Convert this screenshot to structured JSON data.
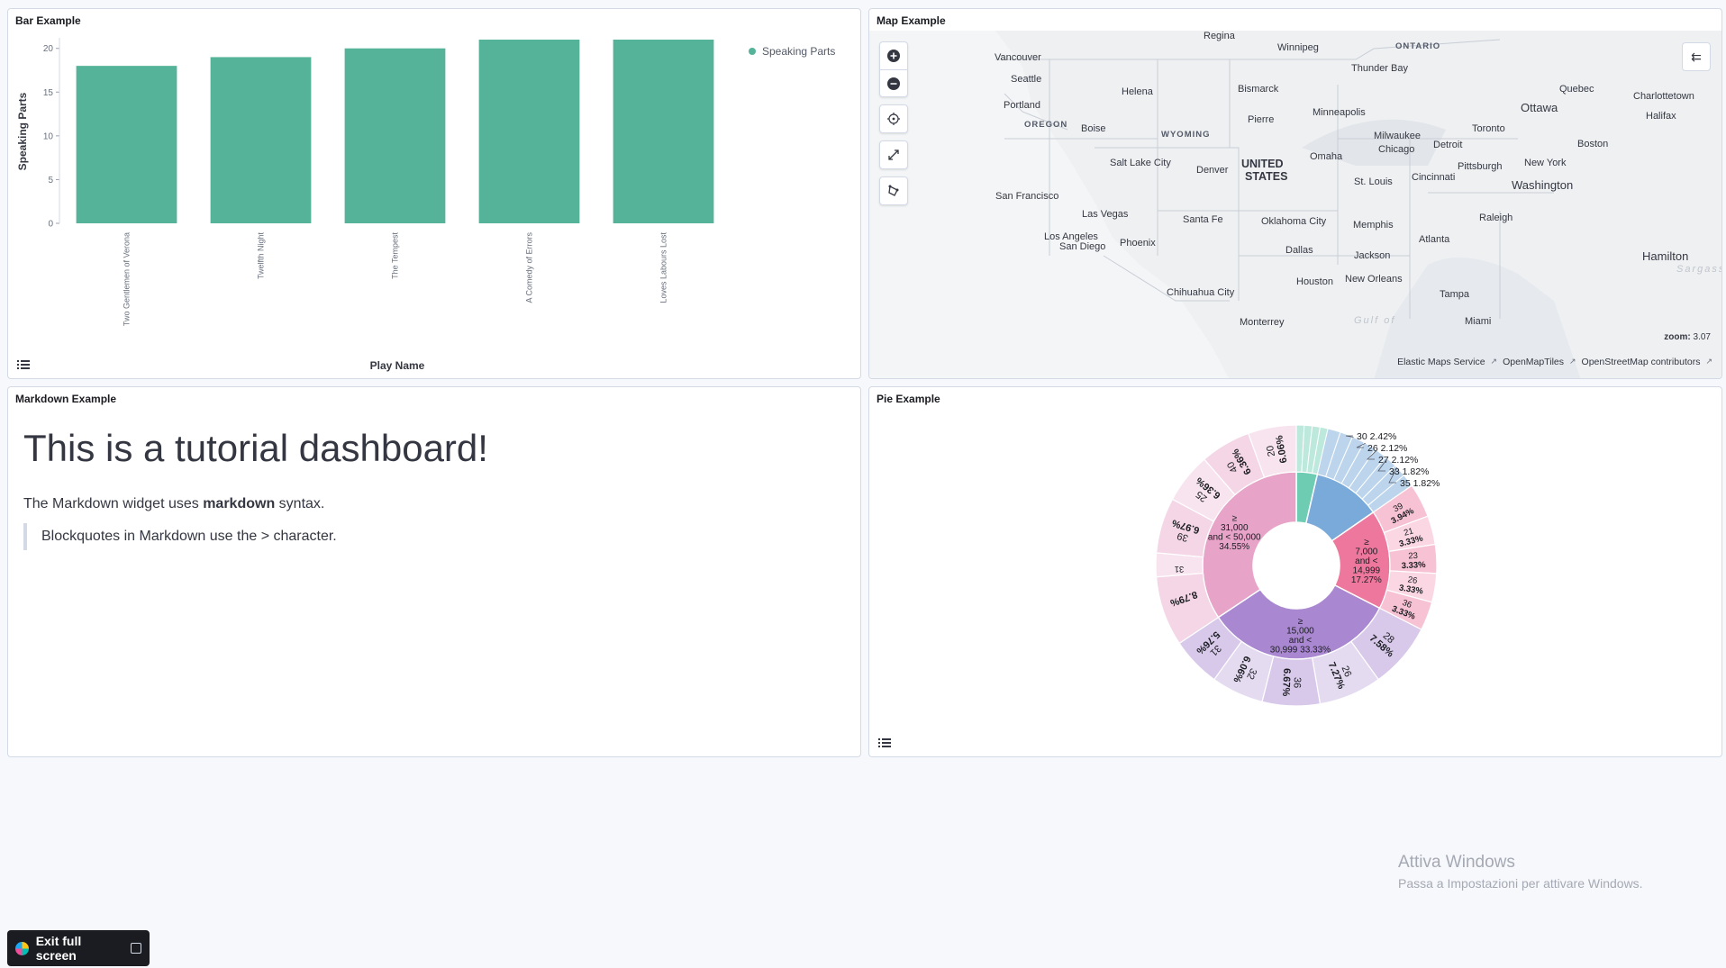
{
  "dashboard": {
    "bar_panel": {
      "title": "Bar Example",
      "legend_label": "Speaking Parts"
    },
    "map_panel": {
      "title": "Map Example",
      "zoom_label": "zoom:",
      "zoom_value": "3.07",
      "attribution": [
        "Elastic Maps Service",
        "OpenMapTiles",
        "OpenStreetMap contributors"
      ],
      "labels": {
        "regina": "Regina",
        "winnipeg": "Winnipeg",
        "ontario": "ONTARIO",
        "vancouver": "Vancouver",
        "thunder_bay": "Thunder Bay",
        "seattle": "Seattle",
        "helena": "Helena",
        "bismarck": "Bismarck",
        "quebec": "Quebec",
        "ottawa": "Ottawa",
        "charlottetown": "Charlottetown",
        "halifax": "Halifax",
        "portland": "Portland",
        "minneapolis": "Minneapolis",
        "oregon": "OREGON",
        "boise": "Boise",
        "wyoming": "WYOMING",
        "pierre": "Pierre",
        "toronto": "Toronto",
        "milwaukee": "Milwaukee",
        "detroit": "Detroit",
        "boston": "Boston",
        "chicago": "Chicago",
        "omaha": "Omaha",
        "salt_lake_city": "Salt Lake City",
        "united_states_1": "UNITED",
        "united_states_2": "STATES",
        "new_york": "New York",
        "pittsburgh": "Pittsburgh",
        "denver": "Denver",
        "washington": "Washington",
        "st_louis": "St. Louis",
        "cincinnati": "Cincinnati",
        "san_francisco": "San Francisco",
        "las_vegas": "Las Vegas",
        "santa_fe": "Santa Fe",
        "oklahoma_city": "Oklahoma City",
        "raleigh": "Raleigh",
        "memphis": "Memphis",
        "los_angeles": "Los Angeles",
        "atlanta": "Atlanta",
        "phoenix": "Phoenix",
        "san_diego": "San Diego",
        "dallas": "Dallas",
        "jackson": "Jackson",
        "hamilton": "Hamilton",
        "sargasso": "Sargass",
        "new_orleans": "New Orleans",
        "houston": "Houston",
        "chihuahua_city": "Chihuahua City",
        "tampa": "Tampa",
        "monterrey": "Monterrey",
        "gulf_of": "Gulf of",
        "miami": "Miami"
      },
      "controls": {
        "zoom_in": "+",
        "zoom_out": "−",
        "layers": "⇇"
      }
    },
    "markdown_panel": {
      "title": "Markdown Example",
      "heading": "This is a tutorial dashboard!",
      "p_before": "The Markdown widget uses ",
      "p_bold": "markdown",
      "p_after": " syntax.",
      "blockquote": "Blockquotes in Markdown use the > character."
    },
    "pie_panel": {
      "title": "Pie Example"
    },
    "exit_button_label": "Exit full screen",
    "watermark_line1": "Attiva Windows",
    "watermark_line2": "Passa a Impostazioni per attivare Windows."
  },
  "chart_data": [
    {
      "type": "bar",
      "title": "",
      "xlabel": "Play Name",
      "ylabel": "Speaking Parts",
      "ylim": [
        0,
        21
      ],
      "yticks": [
        0,
        5,
        10,
        15,
        20
      ],
      "categories": [
        "Two Gentlemen of Verona",
        "Twelfth Night",
        "The Tempest",
        "A Comedy of Errors",
        "Loves Labours Lost"
      ],
      "series": [
        {
          "name": "Speaking Parts",
          "values": [
            18,
            19,
            20,
            21,
            21
          ]
        }
      ],
      "colors": {
        "bar": "#54b399"
      },
      "legend": "top-right",
      "grid": false
    },
    {
      "type": "pie",
      "donut": true,
      "inner_ring": [
        {
          "label_lines": [
            "≥",
            "31,000",
            "and < 50,000",
            "34.55%"
          ],
          "value": 34.55,
          "color": "#e7a4c8"
        },
        {
          "label_lines": [],
          "value": 3.64,
          "color": "#6dccb1"
        },
        {
          "label_lines": [],
          "value": 11.82,
          "color": "#79aad9"
        },
        {
          "label_lines": [
            "≥",
            "7,000",
            "and <",
            "14,999",
            "17.27%"
          ],
          "value": 17.27,
          "color": "#ee789d"
        },
        {
          "label_lines": [
            "≥",
            "15,000",
            "and <",
            "30,999 33.33%"
          ],
          "value": 33.33,
          "color": "#a987d1"
        }
      ],
      "outer_ring": [
        {
          "lines": [
            "20",
            "6.06%"
          ],
          "value": 6.06
        },
        {
          "lines": [
            "40",
            "6.36%"
          ],
          "value": 6.36
        },
        {
          "lines": [
            "25",
            "6.36%"
          ],
          "value": 6.36
        },
        {
          "lines": [
            "39",
            "6.97%"
          ],
          "value": 6.97
        },
        {
          "lines": [
            "31",
            ""
          ],
          "value": 0.0
        },
        {
          "lines": [
            "",
            "8.79%"
          ],
          "value": 8.79
        },
        {
          "lines": [
            "31",
            "5.76%"
          ],
          "value": 5.76
        },
        {
          "lines": [
            "32",
            "6.06%"
          ],
          "value": 6.06
        },
        {
          "lines": [
            "36",
            "6.67%"
          ],
          "value": 6.67
        },
        {
          "lines": [
            "26",
            "7.27%"
          ],
          "value": 7.27
        },
        {
          "lines": [
            "28",
            "7.58%"
          ],
          "value": 7.58
        },
        {
          "lines": [
            "36",
            "3.33%"
          ],
          "value": 3.33
        },
        {
          "lines": [
            "26",
            "3.33%"
          ],
          "value": 3.33
        },
        {
          "lines": [
            "23",
            "3.33%"
          ],
          "value": 3.33
        },
        {
          "lines": [
            "21",
            "3.33%"
          ],
          "value": 3.33
        },
        {
          "lines": [
            "39",
            "3.94%"
          ],
          "value": 3.94
        }
      ],
      "callouts": [
        {
          "label": "30",
          "pct": "2.42%"
        },
        {
          "label": "26",
          "pct": "2.12%"
        },
        {
          "label": "27",
          "pct": "2.12%"
        },
        {
          "label": "33",
          "pct": "1.82%"
        },
        {
          "label": "35",
          "pct": "1.82%"
        }
      ]
    }
  ]
}
